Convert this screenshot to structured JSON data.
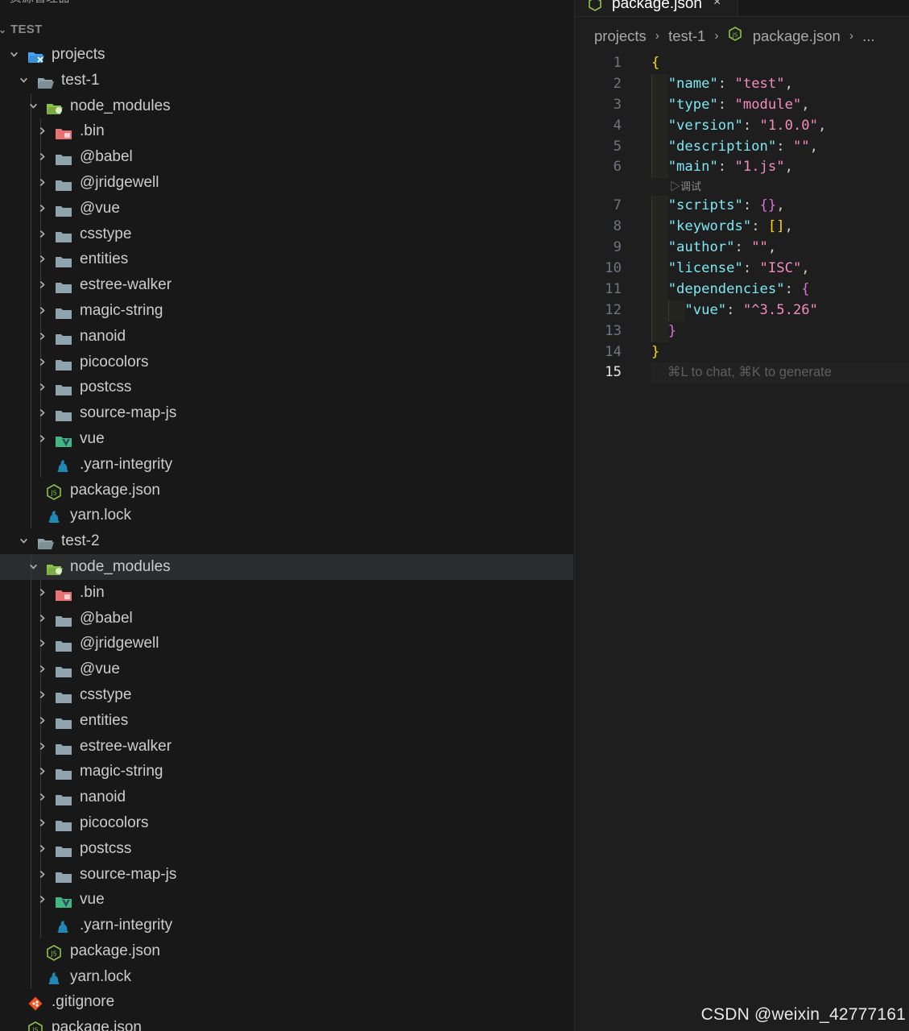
{
  "explorer": {
    "clipped_title": "资源管理器",
    "section_title": "TEST",
    "tree": [
      {
        "label": "projects",
        "depth": 0,
        "type": "folder-special",
        "expanded": true
      },
      {
        "label": "test-1",
        "depth": 1,
        "type": "folder-open",
        "expanded": true
      },
      {
        "label": "node_modules",
        "depth": 2,
        "type": "folder-node",
        "expanded": true
      },
      {
        "label": ".bin",
        "depth": 3,
        "type": "folder-bin",
        "expanded": false
      },
      {
        "label": "@babel",
        "depth": 3,
        "type": "folder",
        "expanded": false
      },
      {
        "label": "@jridgewell",
        "depth": 3,
        "type": "folder",
        "expanded": false
      },
      {
        "label": "@vue",
        "depth": 3,
        "type": "folder",
        "expanded": false
      },
      {
        "label": "csstype",
        "depth": 3,
        "type": "folder",
        "expanded": false
      },
      {
        "label": "entities",
        "depth": 3,
        "type": "folder",
        "expanded": false
      },
      {
        "label": "estree-walker",
        "depth": 3,
        "type": "folder",
        "expanded": false
      },
      {
        "label": "magic-string",
        "depth": 3,
        "type": "folder",
        "expanded": false
      },
      {
        "label": "nanoid",
        "depth": 3,
        "type": "folder",
        "expanded": false
      },
      {
        "label": "picocolors",
        "depth": 3,
        "type": "folder",
        "expanded": false
      },
      {
        "label": "postcss",
        "depth": 3,
        "type": "folder",
        "expanded": false
      },
      {
        "label": "source-map-js",
        "depth": 3,
        "type": "folder",
        "expanded": false
      },
      {
        "label": "vue",
        "depth": 3,
        "type": "folder-vue",
        "expanded": false
      },
      {
        "label": ".yarn-integrity",
        "depth": 3,
        "type": "file-yarn"
      },
      {
        "label": "package.json",
        "depth": 2,
        "type": "file-json"
      },
      {
        "label": "yarn.lock",
        "depth": 2,
        "type": "file-yarn"
      },
      {
        "label": "test-2",
        "depth": 1,
        "type": "folder-open",
        "expanded": true
      },
      {
        "label": "node_modules",
        "depth": 2,
        "type": "folder-node",
        "expanded": true,
        "selected": true
      },
      {
        "label": ".bin",
        "depth": 3,
        "type": "folder-bin",
        "expanded": false
      },
      {
        "label": "@babel",
        "depth": 3,
        "type": "folder",
        "expanded": false
      },
      {
        "label": "@jridgewell",
        "depth": 3,
        "type": "folder",
        "expanded": false
      },
      {
        "label": "@vue",
        "depth": 3,
        "type": "folder",
        "expanded": false
      },
      {
        "label": "csstype",
        "depth": 3,
        "type": "folder",
        "expanded": false
      },
      {
        "label": "entities",
        "depth": 3,
        "type": "folder",
        "expanded": false
      },
      {
        "label": "estree-walker",
        "depth": 3,
        "type": "folder",
        "expanded": false
      },
      {
        "label": "magic-string",
        "depth": 3,
        "type": "folder",
        "expanded": false
      },
      {
        "label": "nanoid",
        "depth": 3,
        "type": "folder",
        "expanded": false
      },
      {
        "label": "picocolors",
        "depth": 3,
        "type": "folder",
        "expanded": false
      },
      {
        "label": "postcss",
        "depth": 3,
        "type": "folder",
        "expanded": false
      },
      {
        "label": "source-map-js",
        "depth": 3,
        "type": "folder",
        "expanded": false
      },
      {
        "label": "vue",
        "depth": 3,
        "type": "folder-vue",
        "expanded": false
      },
      {
        "label": ".yarn-integrity",
        "depth": 3,
        "type": "file-yarn"
      },
      {
        "label": "package.json",
        "depth": 2,
        "type": "file-json"
      },
      {
        "label": "yarn.lock",
        "depth": 2,
        "type": "file-yarn"
      },
      {
        "label": ".gitignore",
        "depth": 0,
        "type": "file-git"
      },
      {
        "label": "package.json",
        "depth": 0,
        "type": "file-json"
      }
    ]
  },
  "editor": {
    "tab": {
      "label": "package.json",
      "close": "×"
    },
    "breadcrumb": {
      "items": [
        "projects",
        "test-1",
        "package.json",
        "..."
      ],
      "separator": "›"
    },
    "codelens": "▷调试",
    "ghost_hint": "⌘L to chat, ⌘K to generate",
    "lines": [
      {
        "n": "1",
        "tokens": [
          {
            "t": "{",
            "c": "b1"
          }
        ]
      },
      {
        "n": "2",
        "tokens": [
          {
            "t": "  "
          },
          {
            "t": "\"name\"",
            "c": "key"
          },
          {
            "t": ": ",
            "c": "p"
          },
          {
            "t": "\"test\"",
            "c": "str"
          },
          {
            "t": ",",
            "c": "p"
          }
        ]
      },
      {
        "n": "3",
        "tokens": [
          {
            "t": "  "
          },
          {
            "t": "\"type\"",
            "c": "key"
          },
          {
            "t": ": ",
            "c": "p"
          },
          {
            "t": "\"module\"",
            "c": "str"
          },
          {
            "t": ",",
            "c": "p"
          }
        ]
      },
      {
        "n": "4",
        "tokens": [
          {
            "t": "  "
          },
          {
            "t": "\"version\"",
            "c": "key"
          },
          {
            "t": ": ",
            "c": "p"
          },
          {
            "t": "\"1.0.0\"",
            "c": "str"
          },
          {
            "t": ",",
            "c": "p"
          }
        ]
      },
      {
        "n": "5",
        "tokens": [
          {
            "t": "  "
          },
          {
            "t": "\"description\"",
            "c": "key"
          },
          {
            "t": ": ",
            "c": "p"
          },
          {
            "t": "\"\"",
            "c": "str"
          },
          {
            "t": ",",
            "c": "p"
          }
        ]
      },
      {
        "n": "6",
        "tokens": [
          {
            "t": "  "
          },
          {
            "t": "\"main\"",
            "c": "key"
          },
          {
            "t": ": ",
            "c": "p"
          },
          {
            "t": "\"1.js\"",
            "c": "str"
          },
          {
            "t": ",",
            "c": "p"
          }
        ],
        "codelens_after": true
      },
      {
        "n": "7",
        "tokens": [
          {
            "t": "  "
          },
          {
            "t": "\"scripts\"",
            "c": "key"
          },
          {
            "t": ": ",
            "c": "p"
          },
          {
            "t": "{}",
            "c": "b2"
          },
          {
            "t": ",",
            "c": "p"
          }
        ]
      },
      {
        "n": "8",
        "tokens": [
          {
            "t": "  "
          },
          {
            "t": "\"keywords\"",
            "c": "key"
          },
          {
            "t": ": ",
            "c": "p"
          },
          {
            "t": "[]",
            "c": "b1"
          },
          {
            "t": ",",
            "c": "p"
          }
        ]
      },
      {
        "n": "9",
        "tokens": [
          {
            "t": "  "
          },
          {
            "t": "\"author\"",
            "c": "key"
          },
          {
            "t": ": ",
            "c": "p"
          },
          {
            "t": "\"\"",
            "c": "str"
          },
          {
            "t": ",",
            "c": "p"
          }
        ]
      },
      {
        "n": "10",
        "tokens": [
          {
            "t": "  "
          },
          {
            "t": "\"license\"",
            "c": "key"
          },
          {
            "t": ": ",
            "c": "p"
          },
          {
            "t": "\"ISC\"",
            "c": "str"
          },
          {
            "t": ",",
            "c": "p"
          }
        ]
      },
      {
        "n": "11",
        "tokens": [
          {
            "t": "  "
          },
          {
            "t": "\"dependencies\"",
            "c": "key"
          },
          {
            "t": ": ",
            "c": "p"
          },
          {
            "t": "{",
            "c": "b2"
          }
        ]
      },
      {
        "n": "12",
        "tokens": [
          {
            "t": "    "
          },
          {
            "t": "\"vue\"",
            "c": "key"
          },
          {
            "t": ": ",
            "c": "p"
          },
          {
            "t": "\"^3.5.26\"",
            "c": "str"
          }
        ]
      },
      {
        "n": "13",
        "tokens": [
          {
            "t": "  "
          },
          {
            "t": "}",
            "c": "b2"
          }
        ]
      },
      {
        "n": "14",
        "tokens": [
          {
            "t": "}",
            "c": "b1"
          }
        ]
      },
      {
        "n": "15",
        "tokens": [],
        "active": true
      }
    ]
  },
  "watermark": "CSDN @weixin_42777161",
  "colors": {
    "background": "#181818",
    "editor_bg": "#1e1e1e",
    "selected_row": "#2a2d2e",
    "folder": "#90a4ae",
    "bin_folder": "#e57373",
    "node_folder": "#8bc34a",
    "vue": "#41b883",
    "yarn": "#2188b6",
    "json_icon": "#8bc34a",
    "git_icon": "#f4511e",
    "json_key": "#7ee7f2",
    "json_string": "#f28cbf",
    "bracket_gold": "#ffd700",
    "bracket_purple": "#da70d6"
  }
}
